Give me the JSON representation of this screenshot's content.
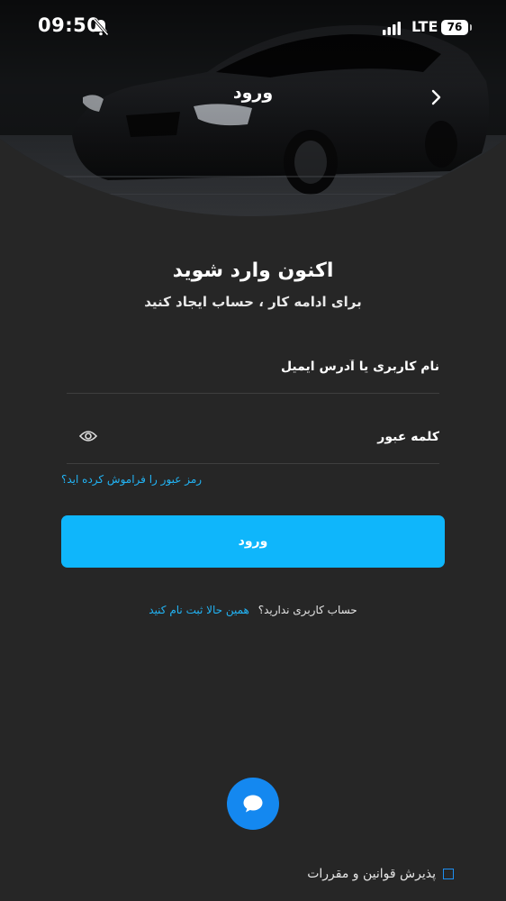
{
  "status_bar": {
    "time": "09:50",
    "network": "LTE",
    "battery": "76"
  },
  "header": {
    "title": "ورود"
  },
  "main": {
    "heading": "اکنون وارد شوید",
    "subheading": "برای ادامه کار ، حساب ایجاد کنید",
    "username_placeholder": "نام کاربری یا آدرس ایمیل",
    "password_placeholder": "کلمه عبور",
    "forgot_password": "رمز عبور را فراموش کرده اید؟",
    "login_button": "ورود",
    "signup_question": "حساب کاربری ندارید؟",
    "signup_link": "همین حالا ثبت نام کنید"
  },
  "footer": {
    "terms_label": "پذیرش قوانین و مقررات"
  },
  "colors": {
    "background": "#262626",
    "accent": "#0fb6fb",
    "link": "#22b4f5",
    "fab": "#1488f0"
  },
  "icons": [
    "bell-off-icon",
    "signal-icon",
    "back-chevron-icon",
    "eye-icon",
    "chat-bubble-icon"
  ]
}
